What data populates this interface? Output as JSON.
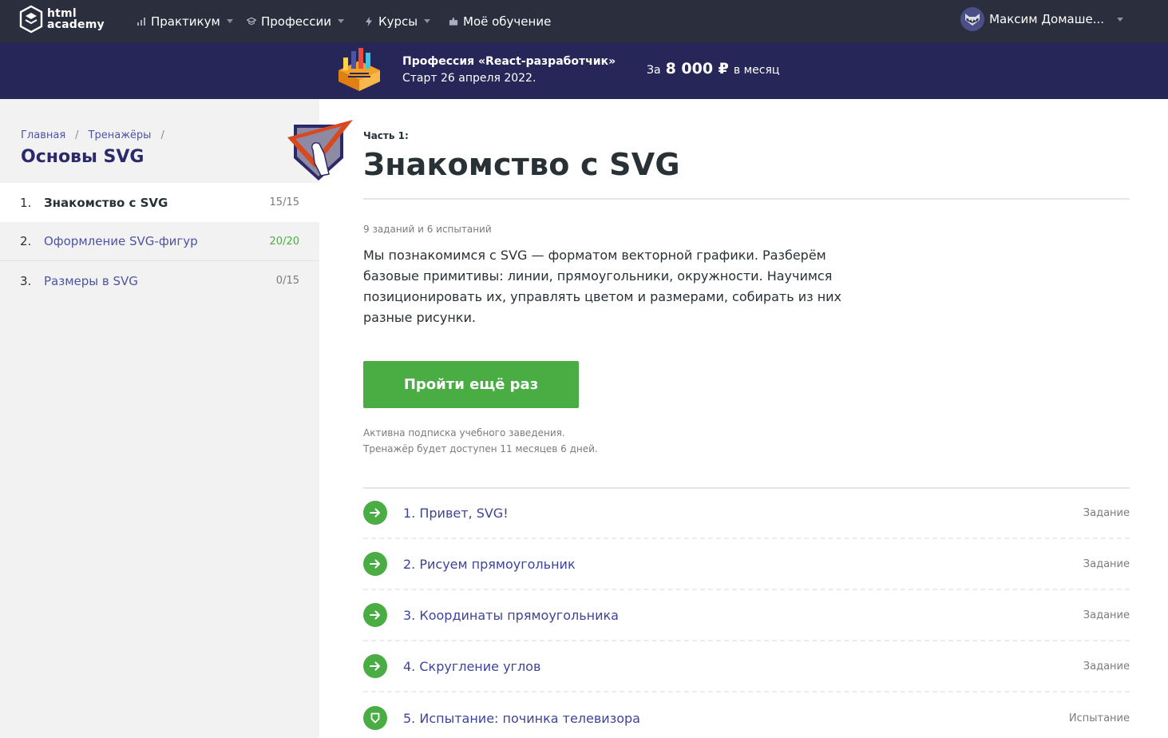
{
  "nav": {
    "logo_line1": "html",
    "logo_line2": "academy",
    "items": [
      {
        "label": "Практикум",
        "icon": "chart-icon"
      },
      {
        "label": "Профессии",
        "icon": "graduation-cap-icon"
      },
      {
        "label": "Курсы",
        "icon": "lightning-icon"
      },
      {
        "label": "Моё обучение",
        "icon": "puzzle-icon"
      }
    ],
    "user_name": "Максим Домаше..."
  },
  "promo": {
    "title": "Профессия «React-разработчик»",
    "date": "Старт 26 апреля 2022.",
    "price_prefix": "За",
    "price": "8 000 ₽",
    "price_suffix": "в месяц"
  },
  "sidebar": {
    "breadcrumbs": [
      "Главная",
      "Тренажёры"
    ],
    "title": "Основы SVG",
    "items": [
      {
        "num": "1.",
        "label": "Знакомство с SVG",
        "count": "15/15"
      },
      {
        "num": "2.",
        "label": "Оформление SVG-фигур",
        "count": "20/20"
      },
      {
        "num": "3.",
        "label": "Размеры в SVG",
        "count": "0/15"
      }
    ]
  },
  "main": {
    "part_label": "Часть 1:",
    "title": "Знакомство с SVG",
    "tasks_count": "9 заданий и 6 испытаний",
    "description": "Мы познакомимся с SVG — форматом векторной графики. Разберём базовые примитивы: линии, прямоугольники, окружности. Научимся позиционировать их, управлять цветом и размерами, собирать из них разные рисунки.",
    "button_label": "Пройти ещё раз",
    "note_line1": "Активна подписка учебного заведения.",
    "note_line2": "Тренажёр будет доступен 11 месяцев 6 дней.",
    "lessons": [
      {
        "title": "1. Привет, SVG!",
        "type": "Задание",
        "icon": "arrow-right-icon"
      },
      {
        "title": "2. Рисуем прямоугольник",
        "type": "Задание",
        "icon": "arrow-right-icon"
      },
      {
        "title": "3. Координаты прямоугольника",
        "type": "Задание",
        "icon": "arrow-right-icon"
      },
      {
        "title": "4. Скругление углов",
        "type": "Задание",
        "icon": "arrow-right-icon"
      },
      {
        "title": "5. Испытание: починка телевизора",
        "type": "Испытание",
        "icon": "shield-icon"
      }
    ]
  },
  "colors": {
    "nav_bg": "#2b2e3c",
    "promo_bg": "#262659",
    "accent_green": "#4aad44",
    "link_blue": "#4d54a6",
    "title_dark": "#2a2a6a"
  }
}
